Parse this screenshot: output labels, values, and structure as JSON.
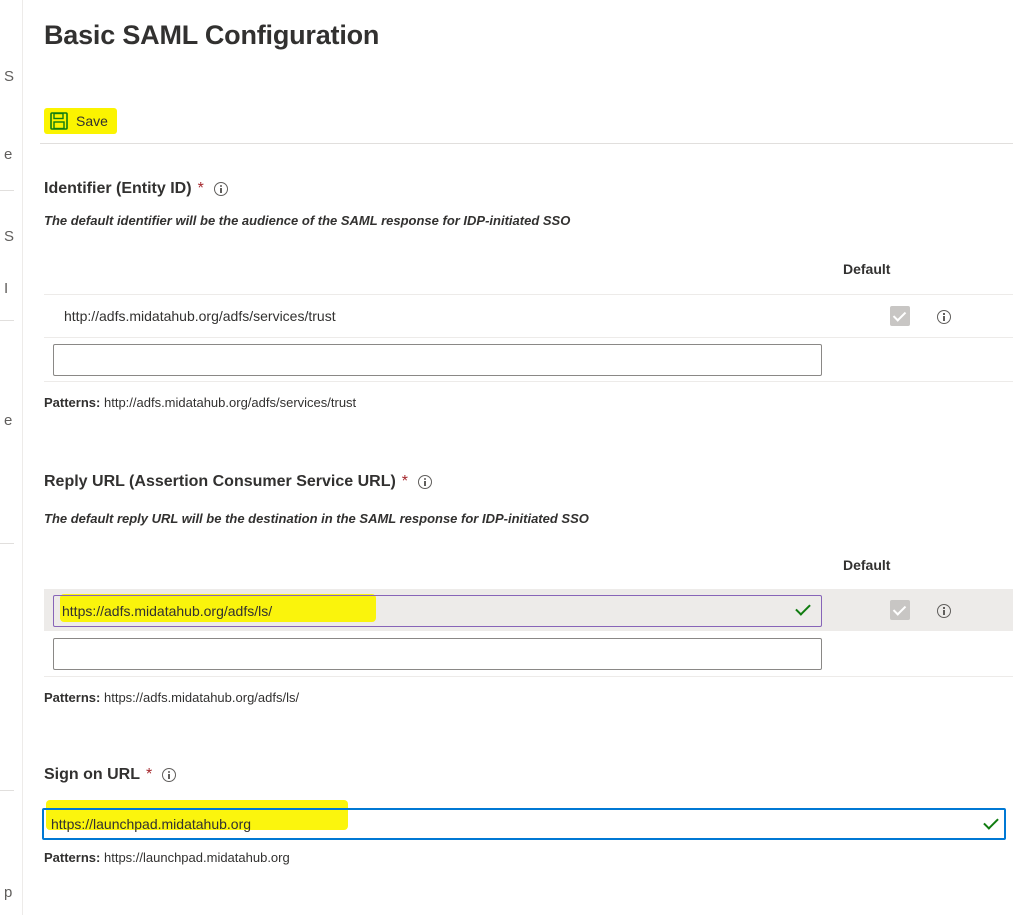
{
  "title": "Basic SAML Configuration",
  "toolbar": {
    "save_label": "Save",
    "save_icon": "floppy-disk-icon",
    "save_icon_color": "#107c10"
  },
  "identifier": {
    "title": "Identifier (Entity ID)",
    "required_mark": "*",
    "description": "The default identifier will be the audience of the SAML response for IDP-initiated SSO",
    "default_header": "Default",
    "rows": [
      {
        "value": "http://adfs.midatahub.org/adfs/services/trust",
        "default_checked": true
      }
    ],
    "new_value": "",
    "patterns_label": "Patterns:",
    "patterns_value": "http://adfs.midatahub.org/adfs/services/trust"
  },
  "reply_url": {
    "title": "Reply URL (Assertion Consumer Service URL)",
    "required_mark": "*",
    "description": "The default reply URL will be the destination in the SAML response for IDP-initiated SSO",
    "default_header": "Default",
    "rows": [
      {
        "value": "https://adfs.midatahub.org/adfs/ls/",
        "default_checked": true
      }
    ],
    "new_value": "",
    "patterns_label": "Patterns:",
    "patterns_value": "https://adfs.midatahub.org/adfs/ls/"
  },
  "sign_on": {
    "title": "Sign on URL",
    "required_mark": "*",
    "value": "https://launchpad.midatahub.org",
    "patterns_label": "Patterns:",
    "patterns_value": "https://launchpad.midatahub.org"
  },
  "left_edge_glyphs": [
    "S",
    "e",
    "S",
    "I",
    "e",
    "p"
  ],
  "colors": {
    "highlight": "#fbf400",
    "required": "#a4262c",
    "valid": "#107c10",
    "focus": "#0078d4"
  }
}
